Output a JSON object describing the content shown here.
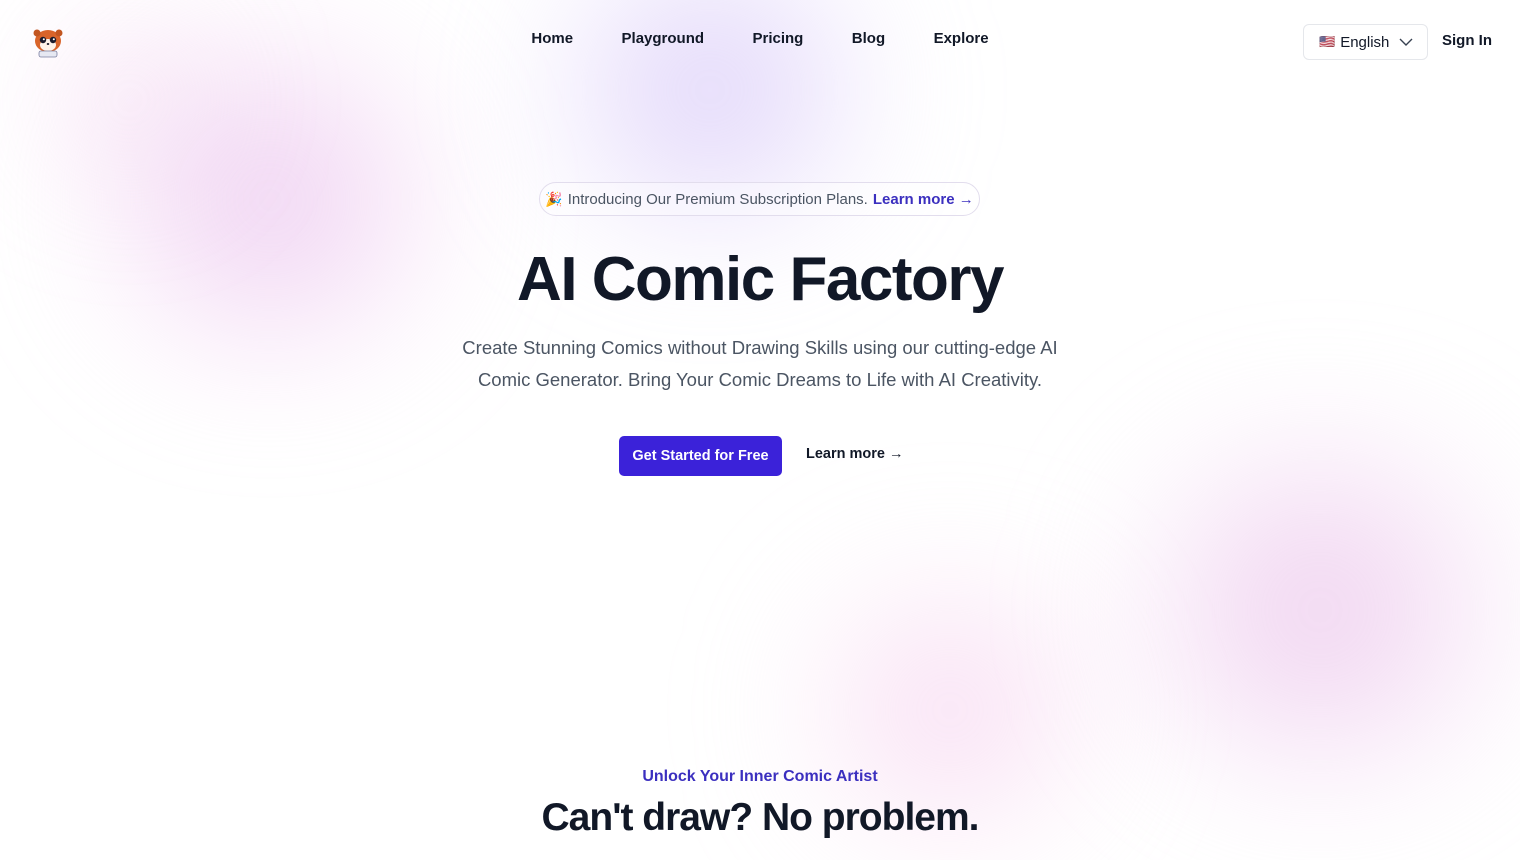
{
  "header": {
    "logo_alt": "AI Comic Factory logo",
    "nav": [
      {
        "label": "Home"
      },
      {
        "label": "Playground"
      },
      {
        "label": "Pricing"
      },
      {
        "label": "Blog"
      },
      {
        "label": "Explore"
      }
    ],
    "language": {
      "flag": "🇺🇸",
      "selected": "English"
    },
    "sign_in": "Sign In"
  },
  "hero": {
    "announcement": {
      "emoji": "🎉",
      "text": "Introducing Our Premium Subscription Plans.",
      "link": "Learn more →"
    },
    "title": "AI Comic Factory",
    "subtitle": "Create Stunning Comics without Drawing Skills using our cutting-edge AI Comic Generator. Bring Your Comic Dreams to Life with AI Creativity.",
    "primary_cta": "Get Started for Free",
    "secondary_cta": "Learn more →"
  },
  "section": {
    "eyebrow": "Unlock Your Inner Comic Artist",
    "title": "Can't draw? No problem."
  },
  "colors": {
    "accent": "#3b22d9",
    "link": "#3b2fbf",
    "text": "#111827"
  }
}
